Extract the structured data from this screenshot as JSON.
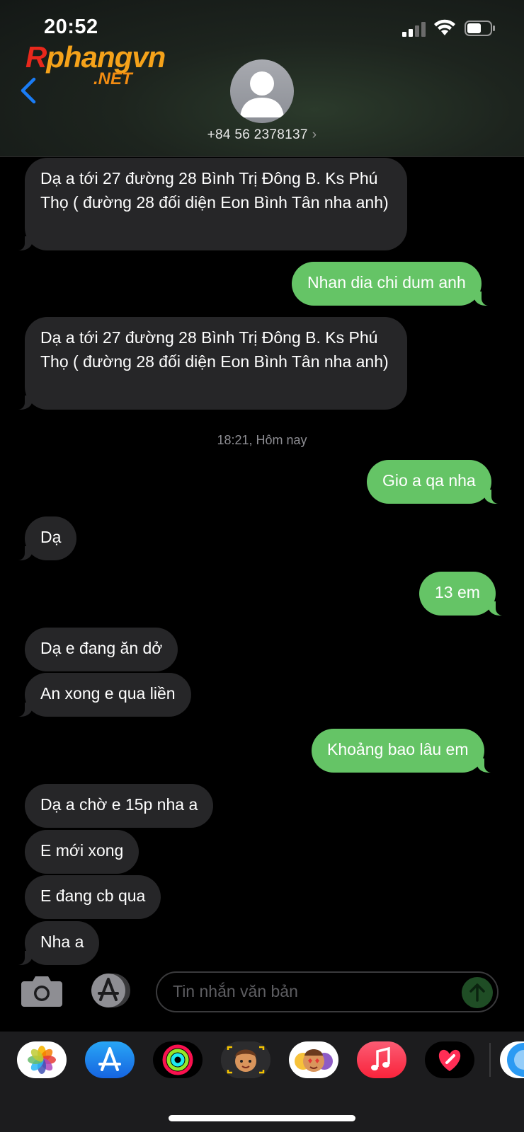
{
  "status_bar": {
    "time": "20:52"
  },
  "watermark": {
    "main": "Rphangvn",
    "sub": ".NET"
  },
  "contact": {
    "phone": "+84 56 2378137",
    "chevron": "›"
  },
  "timestamp": "18:21, Hôm nay",
  "messages": [
    {
      "side": "in",
      "text": "Dạ a tới 27 đường 28 Bình Trị Đông B. Ks Phú Thọ  ( đường 28 đối diện Eon Bình Tân nha anh)"
    },
    {
      "side": "out",
      "text": "Nhan dia chi dum anh"
    },
    {
      "side": "in",
      "text": "Dạ a tới 27 đường 28 Bình Trị Đông B. Ks Phú Thọ  ( đường 28 đối diện Eon Bình Tân nha anh)"
    },
    {
      "side": "out",
      "text": "Gio a qa nha"
    },
    {
      "side": "in",
      "text": "Dạ"
    },
    {
      "side": "out",
      "text": "13 em"
    },
    {
      "side": "in",
      "text": "Dạ e đang ăn dở"
    },
    {
      "side": "in",
      "text": "An xong e qua liền"
    },
    {
      "side": "out",
      "text": "Khoảng bao lâu em"
    },
    {
      "side": "in",
      "text": "Dạ a chờ e 15p nha a"
    },
    {
      "side": "in",
      "text": "E mới xong"
    },
    {
      "side": "in",
      "text": "E đang cb qua"
    },
    {
      "side": "in",
      "text": "Nha a"
    }
  ],
  "composer": {
    "placeholder": "Tin nhắn văn bản"
  },
  "app_drawer": [
    "photos-icon",
    "app-store-icon",
    "activity-icon",
    "memoji-icon",
    "animoji-icon",
    "music-icon",
    "digital-touch-icon",
    "more-apps-icon"
  ],
  "colors": {
    "outgoing": "#65c466",
    "incoming": "#262628",
    "link_blue": "#1a7cf5"
  }
}
